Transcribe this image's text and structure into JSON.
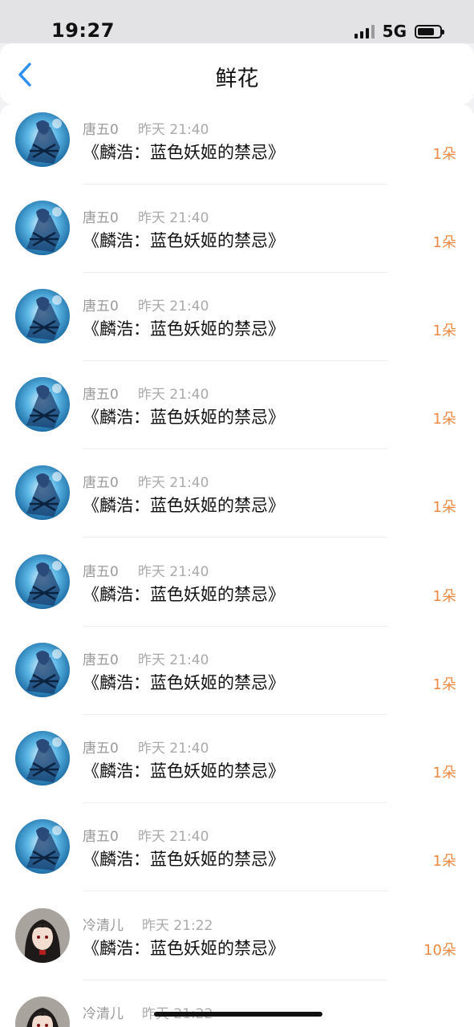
{
  "status_bar": {
    "time": "19:27",
    "network": "5G",
    "battery_level": 0.75
  },
  "header": {
    "title": "鲜花",
    "back_icon": "chevron-left-icon"
  },
  "colors": {
    "accent": "#2f8ff0",
    "amount": "#ef8a43"
  },
  "items": [
    {
      "username": "唐五0",
      "time": "昨天 21:40",
      "title": "《麟浩：蓝色妖姬的禁忌》",
      "amount": "1朵",
      "avatar": "blue-anime-avatar"
    },
    {
      "username": "唐五0",
      "time": "昨天 21:40",
      "title": "《麟浩：蓝色妖姬的禁忌》",
      "amount": "1朵",
      "avatar": "blue-anime-avatar"
    },
    {
      "username": "唐五0",
      "time": "昨天 21:40",
      "title": "《麟浩：蓝色妖姬的禁忌》",
      "amount": "1朵",
      "avatar": "blue-anime-avatar"
    },
    {
      "username": "唐五0",
      "time": "昨天 21:40",
      "title": "《麟浩：蓝色妖姬的禁忌》",
      "amount": "1朵",
      "avatar": "blue-anime-avatar"
    },
    {
      "username": "唐五0",
      "time": "昨天 21:40",
      "title": "《麟浩：蓝色妖姬的禁忌》",
      "amount": "1朵",
      "avatar": "blue-anime-avatar"
    },
    {
      "username": "唐五0",
      "time": "昨天 21:40",
      "title": "《麟浩：蓝色妖姬的禁忌》",
      "amount": "1朵",
      "avatar": "blue-anime-avatar"
    },
    {
      "username": "唐五0",
      "time": "昨天 21:40",
      "title": "《麟浩：蓝色妖姬的禁忌》",
      "amount": "1朵",
      "avatar": "blue-anime-avatar"
    },
    {
      "username": "唐五0",
      "time": "昨天 21:40",
      "title": "《麟浩：蓝色妖姬的禁忌》",
      "amount": "1朵",
      "avatar": "blue-anime-avatar"
    },
    {
      "username": "唐五0",
      "time": "昨天 21:40",
      "title": "《麟浩：蓝色妖姬的禁忌》",
      "amount": "1朵",
      "avatar": "blue-anime-avatar"
    },
    {
      "username": "冷清儿",
      "time": "昨天 21:22",
      "title": "《麟浩：蓝色妖姬的禁忌》",
      "amount": "10朵",
      "avatar": "dark-hair-anime-avatar"
    },
    {
      "username": "冷清儿",
      "time": "昨天 21:22",
      "title": "",
      "amount": "",
      "avatar": "dark-hair-anime-avatar"
    }
  ]
}
